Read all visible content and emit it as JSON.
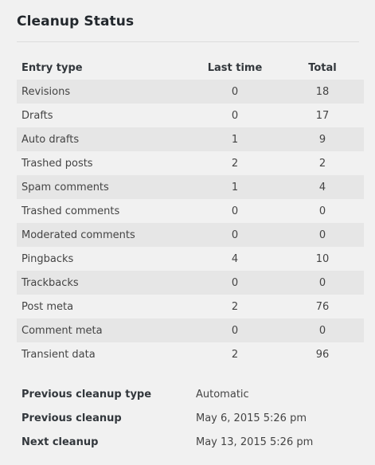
{
  "title": "Cleanup Status",
  "table": {
    "headers": {
      "type": "Entry type",
      "last": "Last time",
      "total": "Total"
    },
    "rows": [
      {
        "type": "Revisions",
        "last": "0",
        "total": "18"
      },
      {
        "type": "Drafts",
        "last": "0",
        "total": "17"
      },
      {
        "type": "Auto drafts",
        "last": "1",
        "total": "9"
      },
      {
        "type": "Trashed posts",
        "last": "2",
        "total": "2"
      },
      {
        "type": "Spam comments",
        "last": "1",
        "total": "4"
      },
      {
        "type": "Trashed comments",
        "last": "0",
        "total": "0"
      },
      {
        "type": "Moderated comments",
        "last": "0",
        "total": "0"
      },
      {
        "type": "Pingbacks",
        "last": "4",
        "total": "10"
      },
      {
        "type": "Trackbacks",
        "last": "0",
        "total": "0"
      },
      {
        "type": "Post meta",
        "last": "2",
        "total": "76"
      },
      {
        "type": "Comment meta",
        "last": "0",
        "total": "0"
      },
      {
        "type": "Transient data",
        "last": "2",
        "total": "96"
      }
    ]
  },
  "info": [
    {
      "label": "Previous cleanup type",
      "value": "Automatic"
    },
    {
      "label": "Previous cleanup",
      "value": "May 6, 2015 5:26 pm"
    },
    {
      "label": "Next cleanup",
      "value": "May 13, 2015 5:26 pm"
    }
  ]
}
